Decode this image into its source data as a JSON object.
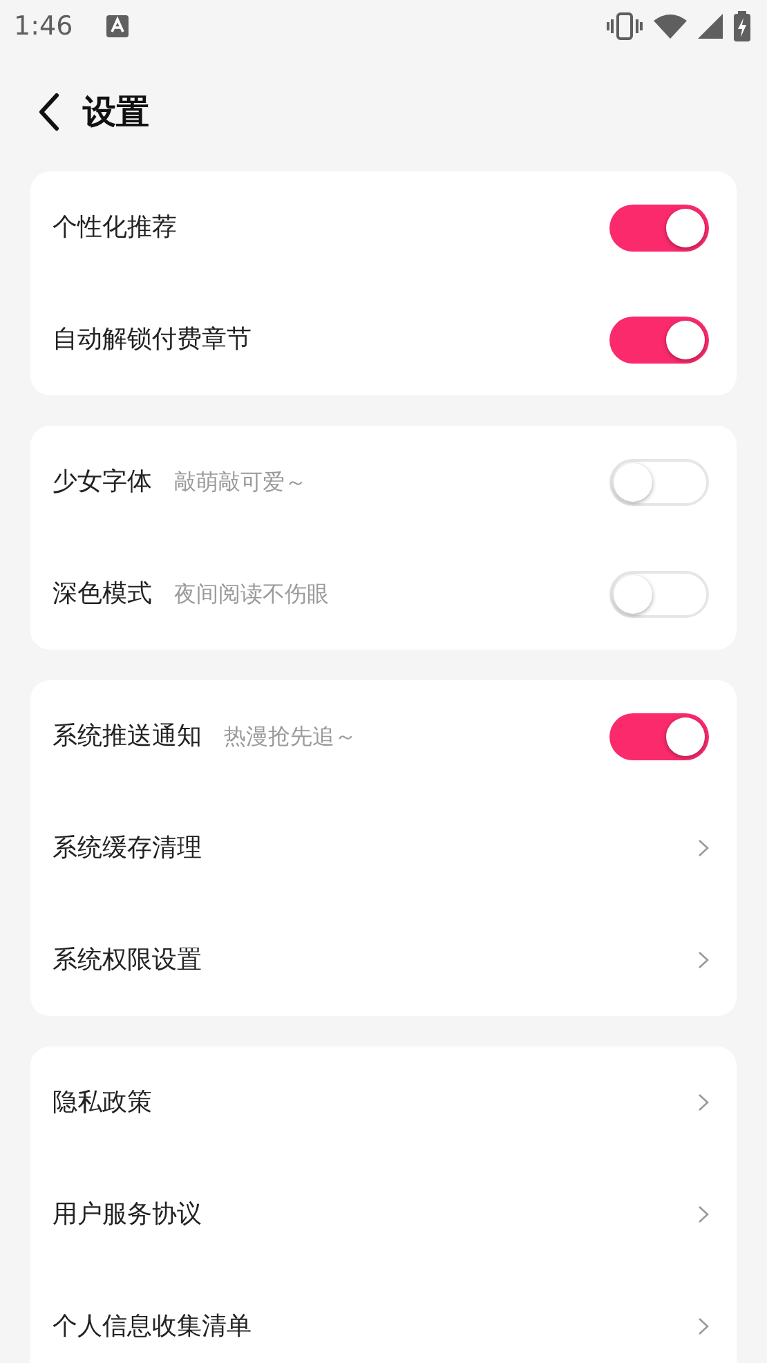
{
  "status_bar": {
    "time": "1:46"
  },
  "header": {
    "title": "设置"
  },
  "groups": [
    {
      "rows": [
        {
          "kind": "toggle",
          "label": "个性化推荐",
          "on": true
        },
        {
          "kind": "toggle",
          "label": "自动解锁付费章节",
          "on": true
        }
      ]
    },
    {
      "rows": [
        {
          "kind": "toggle",
          "label": "少女字体",
          "hint": "敲萌敲可爱～",
          "on": false
        },
        {
          "kind": "toggle",
          "label": "深色模式",
          "hint": "夜间阅读不伤眼",
          "on": false
        }
      ]
    },
    {
      "rows": [
        {
          "kind": "toggle",
          "label": "系统推送通知",
          "hint": "热漫抢先追～",
          "on": true
        },
        {
          "kind": "link",
          "label": "系统缓存清理"
        },
        {
          "kind": "link",
          "label": "系统权限设置"
        }
      ]
    },
    {
      "rows": [
        {
          "kind": "link",
          "label": "隐私政策"
        },
        {
          "kind": "link",
          "label": "用户服务协议"
        },
        {
          "kind": "link",
          "label": "个人信息收集清单"
        }
      ]
    }
  ]
}
